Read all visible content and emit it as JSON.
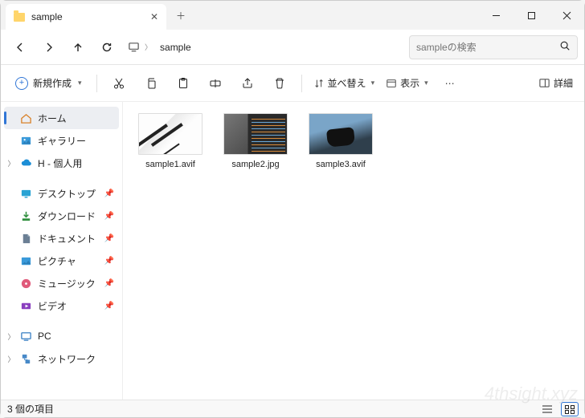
{
  "tab": {
    "title": "sample"
  },
  "nav": {
    "breadcrumb_icon": "monitor",
    "breadcrumb_segment": "sample",
    "search_placeholder": "sampleの検索"
  },
  "toolbar": {
    "new_label": "新規作成",
    "sort_label": "並べ替え",
    "view_label": "表示",
    "details_label": "詳細"
  },
  "sidebar": {
    "home": "ホーム",
    "gallery": "ギャラリー",
    "onedrive": "H - 個人用",
    "desktop": "デスクトップ",
    "downloads": "ダウンロード",
    "documents": "ドキュメント",
    "pictures": "ピクチャ",
    "music": "ミュージック",
    "videos": "ビデオ",
    "pc": "PC",
    "network": "ネットワーク"
  },
  "files": [
    {
      "name": "sample1.avif"
    },
    {
      "name": "sample2.jpg"
    },
    {
      "name": "sample3.avif"
    }
  ],
  "status": {
    "count_text": "3 個の項目"
  },
  "watermark": "4thsight.xyz"
}
